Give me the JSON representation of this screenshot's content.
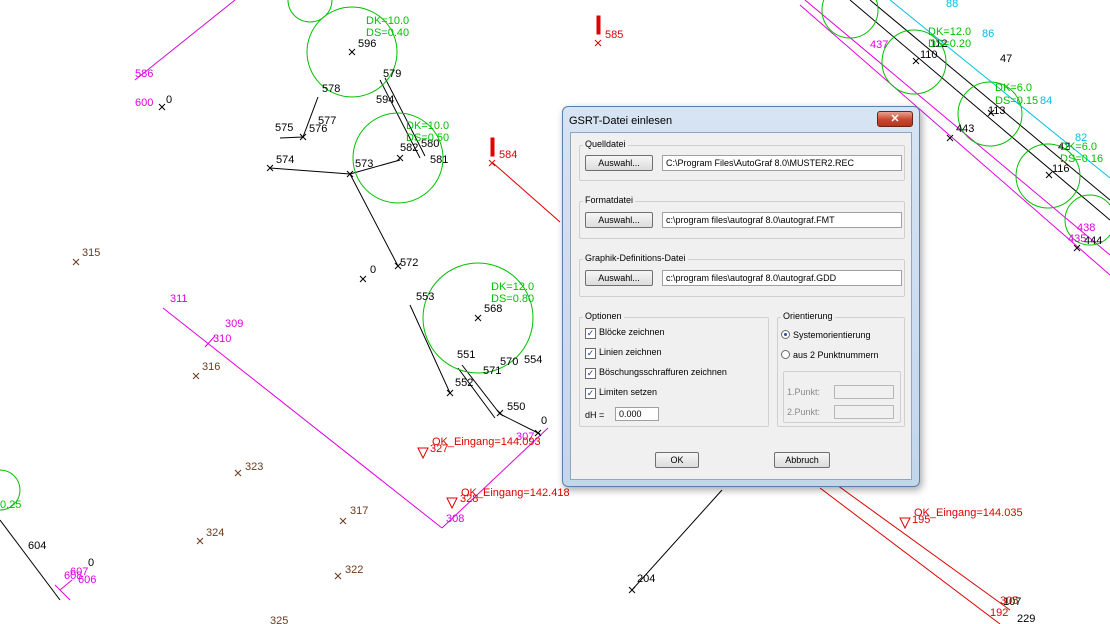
{
  "drawing": {
    "points_black": [
      {
        "label": "596"
      },
      {
        "label": "579"
      },
      {
        "label": "578"
      },
      {
        "label": "594"
      },
      {
        "label": "575"
      },
      {
        "label": "576"
      },
      {
        "label": "577"
      },
      {
        "label": "574"
      },
      {
        "label": "573"
      },
      {
        "label": "582"
      },
      {
        "label": "580"
      },
      {
        "label": "581"
      },
      {
        "label": "572"
      },
      {
        "label": "0"
      },
      {
        "label": "553"
      },
      {
        "label": "568"
      },
      {
        "label": "551"
      },
      {
        "label": "552"
      },
      {
        "label": "571"
      },
      {
        "label": "570"
      },
      {
        "label": "554"
      },
      {
        "label": "550"
      },
      {
        "label": "0"
      },
      {
        "label": "604"
      },
      {
        "label": "0"
      },
      {
        "label": "204"
      },
      {
        "label": "47"
      },
      {
        "label": "116"
      },
      {
        "label": "443"
      },
      {
        "label": "113"
      },
      {
        "label": "444"
      },
      {
        "label": "0"
      },
      {
        "label": "229"
      },
      {
        "label": "107"
      }
    ],
    "points_brown": [
      {
        "label": "315"
      },
      {
        "label": "316"
      },
      {
        "label": "323"
      },
      {
        "label": "317"
      },
      {
        "label": "324"
      },
      {
        "label": "322"
      },
      {
        "label": "325"
      }
    ],
    "points_magenta": [
      {
        "label": "586"
      },
      {
        "label": "600"
      },
      {
        "label": "311"
      },
      {
        "label": "309"
      },
      {
        "label": "310"
      },
      {
        "label": "308"
      },
      {
        "label": "307"
      },
      {
        "label": "437"
      },
      {
        "label": "438"
      },
      {
        "label": "435"
      },
      {
        "label": "606"
      },
      {
        "label": "607"
      },
      {
        "label": "608"
      }
    ],
    "points_red": [
      {
        "label": "585"
      },
      {
        "label": "584"
      },
      {
        "label": "327"
      },
      {
        "label": "328"
      },
      {
        "label": "195"
      },
      {
        "label": "192"
      },
      {
        "label": "305"
      }
    ],
    "tree_labels": [
      {
        "dk": "DK=10.0",
        "ds": "DS=0.40"
      },
      {
        "dk": "DK=10.0",
        "ds": "DS=0.50"
      },
      {
        "dk": "DK=12.0",
        "ds": "DS=0.80"
      },
      {
        "dk": "DK=12.0",
        "ds": "DS=0.20"
      },
      {
        "dk": "DK=6.0",
        "ds": "DS=0.15"
      },
      {
        "dk": "DK=6.0",
        "ds": "DS=0.16"
      }
    ],
    "cyan_labels": [
      "88",
      "86",
      "84",
      "82"
    ],
    "tree_right_labels": [
      "112",
      "110",
      "42"
    ],
    "tree_left_partial": [
      "0.25"
    ],
    "ok_labels": [
      "OK_Eingang=144.093",
      "OK_Eingang=142.418",
      "OK_Eingang=144.035"
    ],
    "colors": {
      "black": "#000000",
      "brown": "#6b3a1e",
      "magenta": "#e000e0",
      "red": "#e00000",
      "green": "#00c000",
      "cyan": "#00c0e0"
    }
  },
  "dialog": {
    "title": "GSRT-Datei einlesen",
    "close_icon": "close-icon",
    "quelldatei": {
      "label": "Quelldatei",
      "button": "Auswahl...",
      "path": "C:\\Program Files\\AutoGraf 8.0\\MUSTER2.REC"
    },
    "formatdatei": {
      "label": "Formatdatei",
      "button": "Auswahl...",
      "path": "c:\\program files\\autograf 8.0\\autograf.FMT"
    },
    "graphik": {
      "label": "Graphik-Definitions-Datei",
      "button": "Auswahl...",
      "path": "c:\\program files\\autograf 8.0\\autograf.GDD"
    },
    "optionen": {
      "label": "Optionen",
      "checkboxes": [
        {
          "label": "Blöcke zeichnen",
          "checked": true
        },
        {
          "label": "Linien zeichnen",
          "checked": true
        },
        {
          "label": "Böschungsschraffuren zeichnen",
          "checked": true
        },
        {
          "label": "Limiten setzen",
          "checked": true
        }
      ],
      "dh_label": "dH =",
      "dh_value": "0.000"
    },
    "orientierung": {
      "label": "Orientierung",
      "radios": [
        {
          "label": "Systemorientierung",
          "selected": true
        },
        {
          "label": "aus 2 Punktnummern",
          "selected": false
        }
      ],
      "punkt1_label": "1.Punkt:",
      "punkt2_label": "2.Punkt:"
    },
    "ok_button": "OK",
    "cancel_button": "Abbruch"
  }
}
